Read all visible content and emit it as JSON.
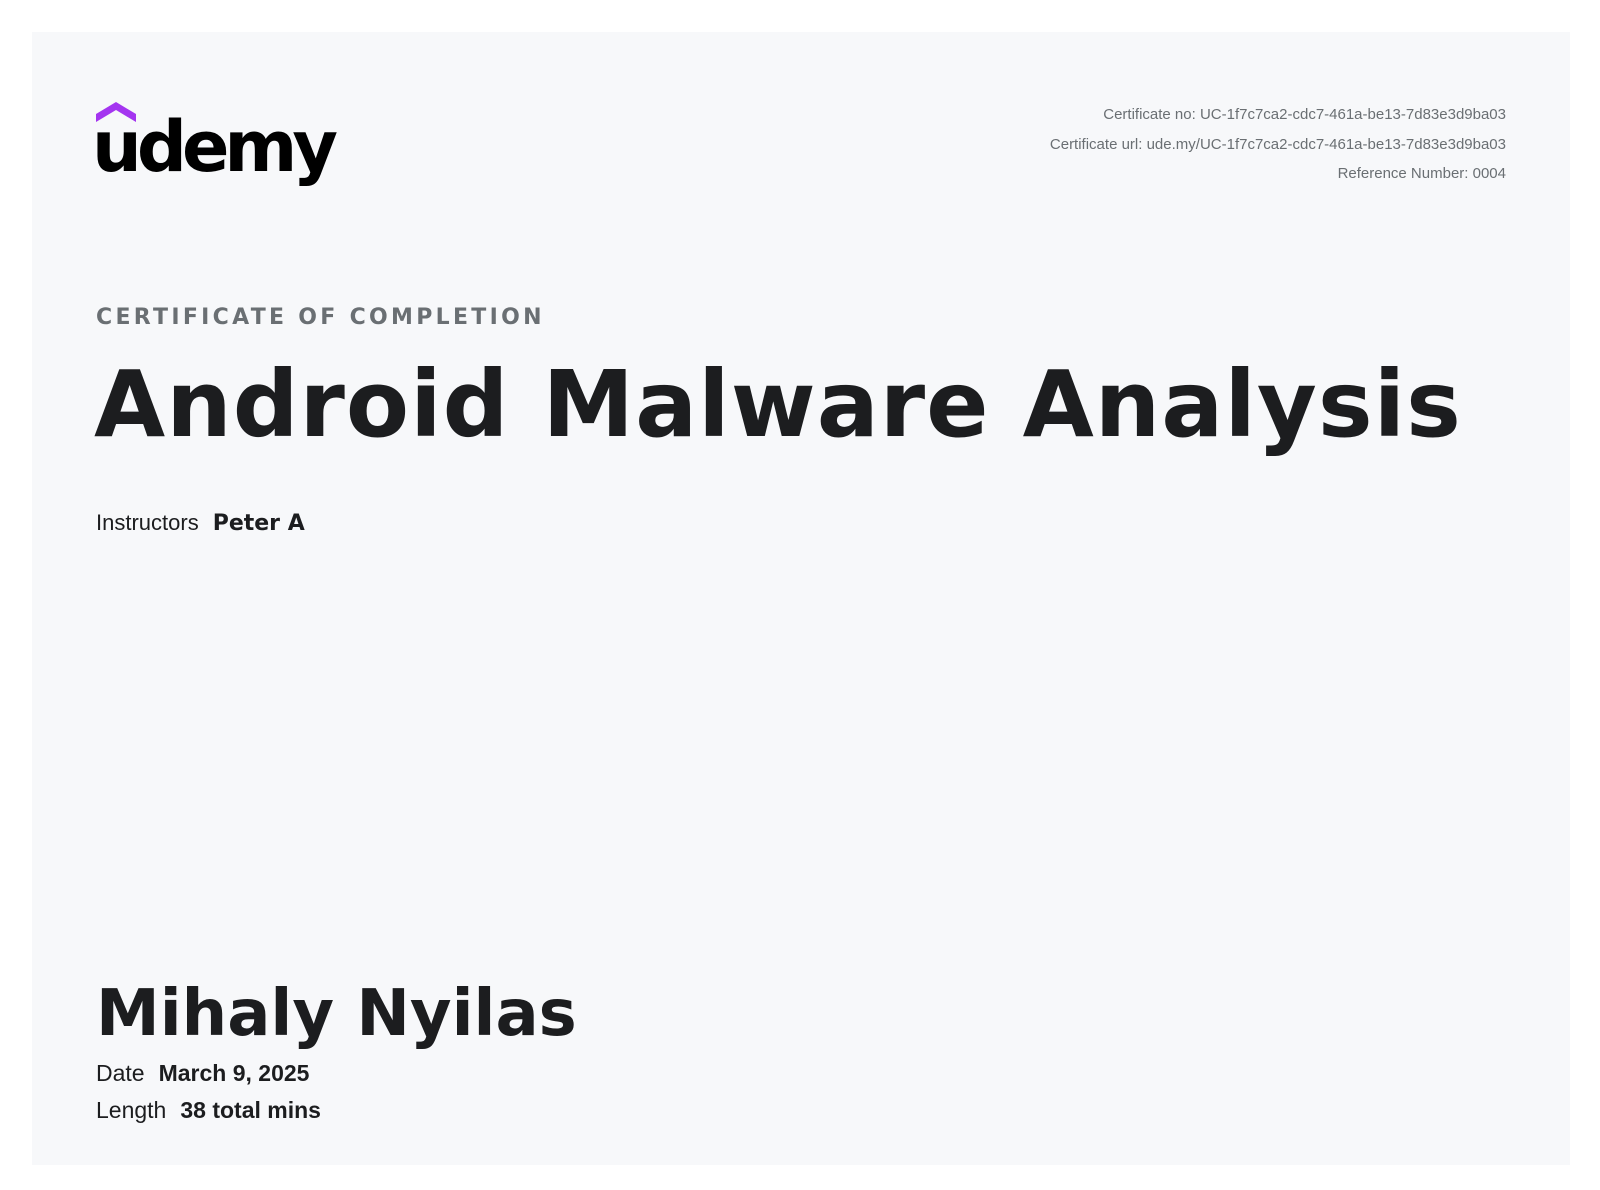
{
  "logo": {
    "wordmark": "udemy",
    "brand_color": "#a435f0",
    "text_color": "#000000"
  },
  "meta": {
    "certificate_no": "Certificate no: UC-1f7c7ca2-cdc7-461a-be13-7d83e3d9ba03",
    "certificate_url": "Certificate url: ude.my/UC-1f7c7ca2-cdc7-461a-be13-7d83e3d9ba03",
    "reference_number": "Reference Number: 0004"
  },
  "heading": {
    "kicker": "CERTIFICATE OF COMPLETION",
    "course_title": "Android Malware Analysis"
  },
  "instructors": {
    "label": "Instructors",
    "name": "Peter A"
  },
  "recipient": {
    "name": "Mihaly Nyilas"
  },
  "details": {
    "date_label": "Date",
    "date_value": "March 9, 2025",
    "length_label": "Length",
    "length_value": "38 total mins"
  },
  "colors": {
    "background": "#f7f8fa",
    "text_primary": "#1c1d1f",
    "text_muted": "#6a6f73"
  }
}
